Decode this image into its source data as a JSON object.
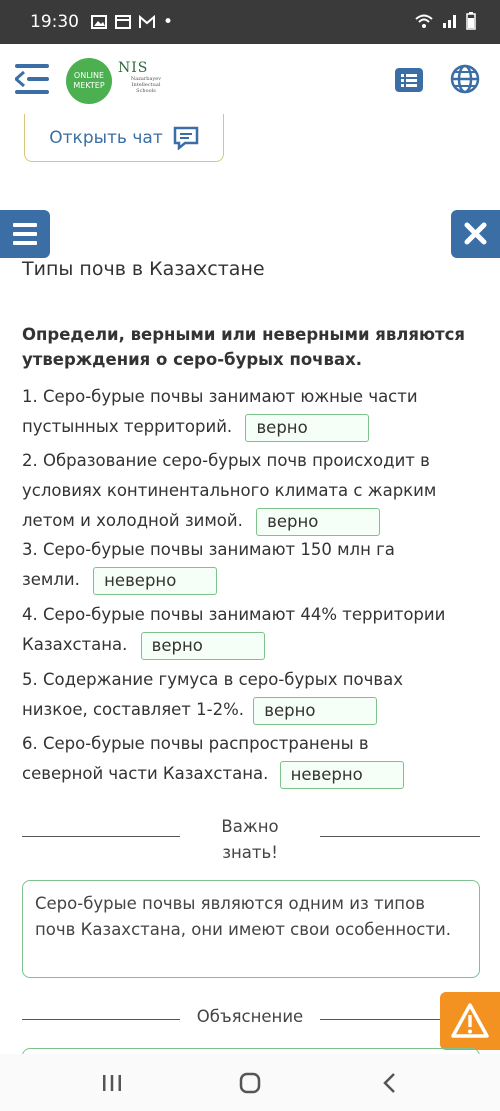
{
  "status_bar": {
    "time": "19:30",
    "dot": "•"
  },
  "header": {
    "logo_line1": "ONLINE",
    "logo_line2": "MEKTEP",
    "nis_text": "NIS",
    "nis_small": "Nazarbayev Intellectual Schools"
  },
  "chat_button": {
    "label": "Открыть чат"
  },
  "page": {
    "title": "Типы почв в Казахстане",
    "question": "Определи, верными или неверными являются утверждения о серо-бурых почвах."
  },
  "statements": [
    {
      "line1": "1. Серо-бурые почвы занимают южные части",
      "line2": "пустынных территорий.",
      "answer": "верно"
    },
    {
      "line1": "2. Образование серо-бурых почв происходит в",
      "line2": "условиях континентального климата с жарким",
      "line3": "летом и холодной зимой.",
      "answer": "верно"
    },
    {
      "line1": "3. Серо-бурые почвы занимают 150 млн га",
      "line2": "земли.",
      "answer": "неверно"
    },
    {
      "line1": "4. Серо-бурые почвы занимают 44% территории",
      "line2": "Казахстана.",
      "answer": "верно"
    },
    {
      "line1": "5. Содержание гумуса в серо-бурых почвах",
      "line2": "низкое, составляет 1-2%.",
      "answer": "верно"
    },
    {
      "line1": "6. Серо-бурые почвы распространены в",
      "line2": "северной части Казахстана.",
      "answer": "неверно"
    }
  ],
  "important": {
    "line1": "Важно",
    "line2": "знать!"
  },
  "info": {
    "text": "Серо-бурые почвы являются одним из типов почв Казахстана, они имеют свои особенности."
  },
  "explanation": {
    "label": "Объяснение"
  },
  "colors": {
    "accent": "#3b6ea5",
    "answer_border": "#7cc28a",
    "warning": "#f39221",
    "status_bar": "#3a3a3a"
  }
}
